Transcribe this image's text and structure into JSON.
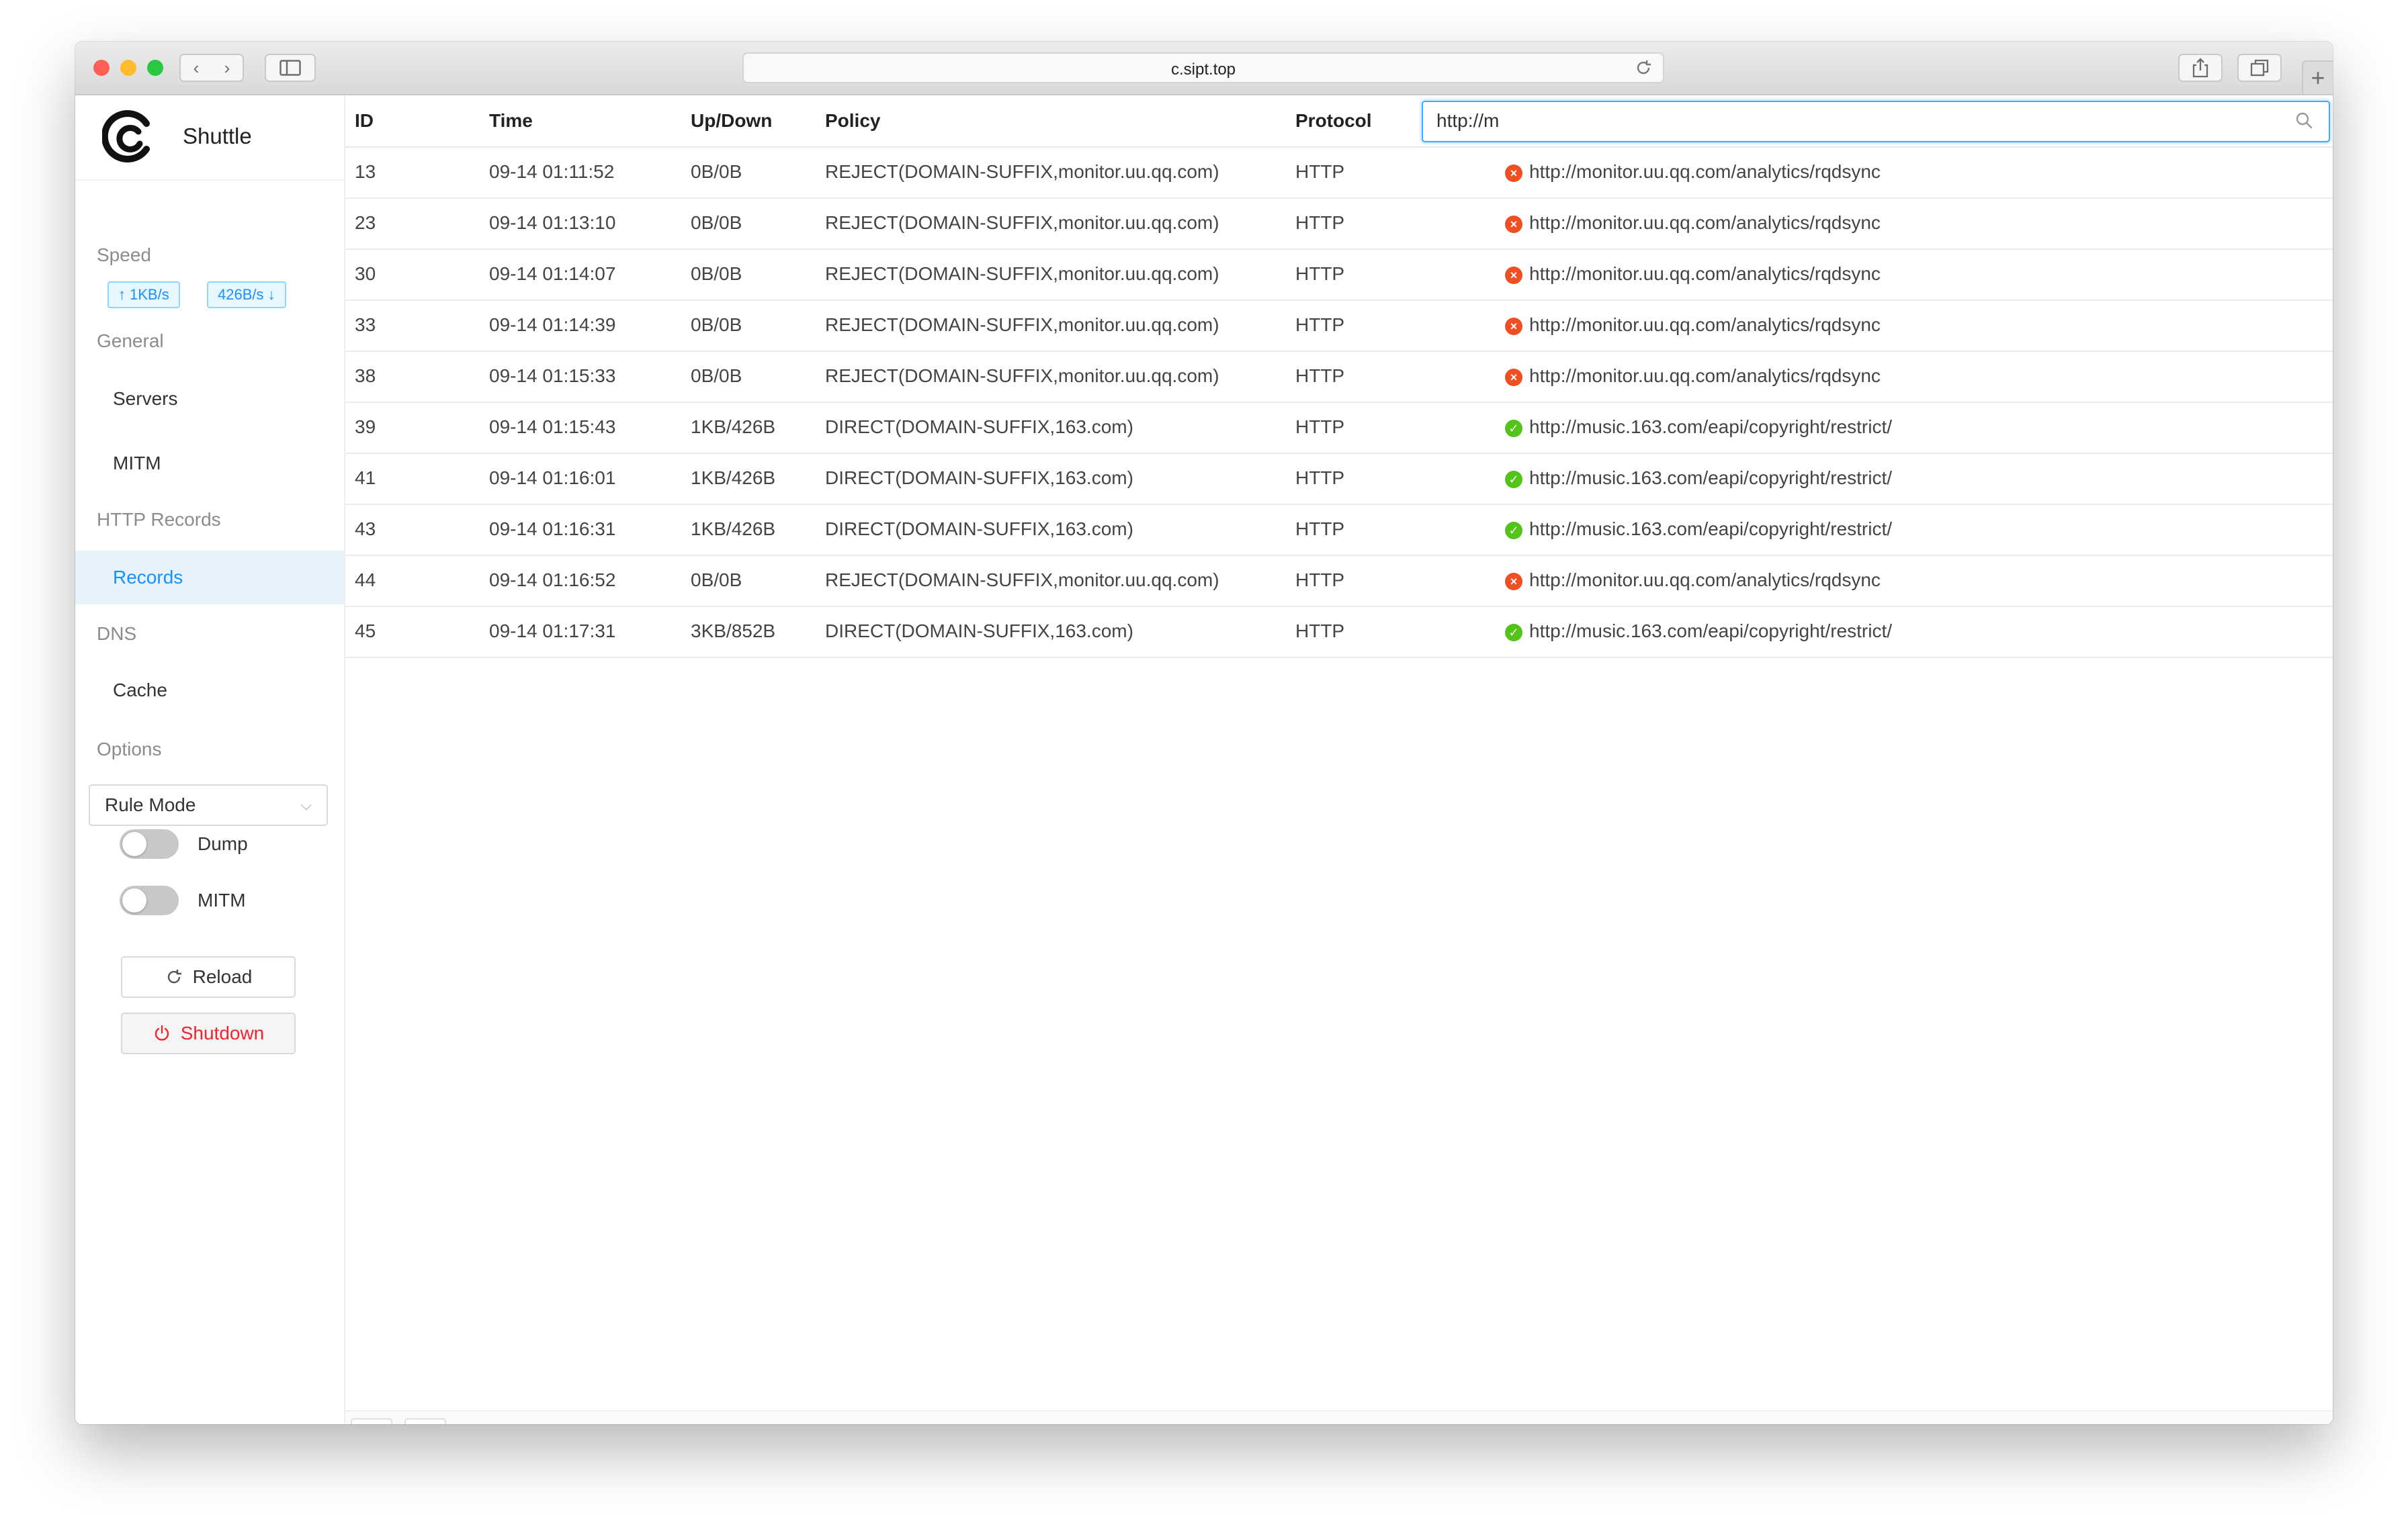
{
  "browser": {
    "url": "c.sipt.top",
    "back_icon": "‹",
    "forward_icon": "›",
    "new_tab_label": "+"
  },
  "app": {
    "name": "Shuttle"
  },
  "sidebar": {
    "speed_label": "Speed",
    "upload_speed": "1KB/s",
    "download_speed": "426B/s",
    "general_label": "General",
    "servers_label": "Servers",
    "mitm_label": "MITM",
    "http_records_label": "HTTP Records",
    "records_label": "Records",
    "dns_label": "DNS",
    "cache_label": "Cache",
    "options_label": "Options",
    "mode_select_value": "Rule Mode",
    "dump_label": "Dump",
    "mitm_toggle_label": "MITM",
    "reload_label": "Reload",
    "shutdown_label": "Shutdown"
  },
  "table": {
    "columns": {
      "id": "ID",
      "time": "Time",
      "updown": "Up/Down",
      "policy": "Policy",
      "protocol": "Protocol"
    },
    "search_value": "http://m",
    "rows": [
      {
        "id": "13",
        "time": "09-14 01:11:52",
        "updown": "0B/0B",
        "policy": "REJECT(DOMAIN-SUFFIX,monitor.uu.qq.com)",
        "protocol": "HTTP",
        "status": "reject",
        "url": "http://monitor.uu.qq.com/analytics/rqdsync"
      },
      {
        "id": "23",
        "time": "09-14 01:13:10",
        "updown": "0B/0B",
        "policy": "REJECT(DOMAIN-SUFFIX,monitor.uu.qq.com)",
        "protocol": "HTTP",
        "status": "reject",
        "url": "http://monitor.uu.qq.com/analytics/rqdsync"
      },
      {
        "id": "30",
        "time": "09-14 01:14:07",
        "updown": "0B/0B",
        "policy": "REJECT(DOMAIN-SUFFIX,monitor.uu.qq.com)",
        "protocol": "HTTP",
        "status": "reject",
        "url": "http://monitor.uu.qq.com/analytics/rqdsync"
      },
      {
        "id": "33",
        "time": "09-14 01:14:39",
        "updown": "0B/0B",
        "policy": "REJECT(DOMAIN-SUFFIX,monitor.uu.qq.com)",
        "protocol": "HTTP",
        "status": "reject",
        "url": "http://monitor.uu.qq.com/analytics/rqdsync"
      },
      {
        "id": "38",
        "time": "09-14 01:15:33",
        "updown": "0B/0B",
        "policy": "REJECT(DOMAIN-SUFFIX,monitor.uu.qq.com)",
        "protocol": "HTTP",
        "status": "reject",
        "url": "http://monitor.uu.qq.com/analytics/rqdsync"
      },
      {
        "id": "39",
        "time": "09-14 01:15:43",
        "updown": "1KB/426B",
        "policy": "DIRECT(DOMAIN-SUFFIX,163.com)",
        "protocol": "HTTP",
        "status": "direct",
        "url": "http://music.163.com/eapi/copyright/restrict/"
      },
      {
        "id": "41",
        "time": "09-14 01:16:01",
        "updown": "1KB/426B",
        "policy": "DIRECT(DOMAIN-SUFFIX,163.com)",
        "protocol": "HTTP",
        "status": "direct",
        "url": "http://music.163.com/eapi/copyright/restrict/"
      },
      {
        "id": "43",
        "time": "09-14 01:16:31",
        "updown": "1KB/426B",
        "policy": "DIRECT(DOMAIN-SUFFIX,163.com)",
        "protocol": "HTTP",
        "status": "direct",
        "url": "http://music.163.com/eapi/copyright/restrict/"
      },
      {
        "id": "44",
        "time": "09-14 01:16:52",
        "updown": "0B/0B",
        "policy": "REJECT(DOMAIN-SUFFIX,monitor.uu.qq.com)",
        "protocol": "HTTP",
        "status": "reject",
        "url": "http://monitor.uu.qq.com/analytics/rqdsync"
      },
      {
        "id": "45",
        "time": "09-14 01:17:31",
        "updown": "3KB/852B",
        "policy": "DIRECT(DOMAIN-SUFFIX,163.com)",
        "protocol": "HTTP",
        "status": "direct",
        "url": "http://music.163.com/eapi/copyright/restrict/"
      }
    ]
  },
  "colors": {
    "accent": "#1890ff",
    "reject": "#f04e23",
    "direct": "#52c41a",
    "danger": "#f5222d",
    "active_bg": "#e6f3fb"
  },
  "icons": {
    "reject": "close-circle-icon",
    "direct": "check-circle-icon",
    "refresh": "refresh-icon",
    "delete": "trash-icon"
  }
}
